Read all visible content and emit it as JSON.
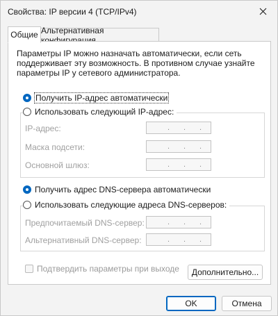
{
  "window": {
    "title": "Свойства: IP версии 4 (TCP/IPv4)"
  },
  "tabs": [
    {
      "label": "Общие",
      "active": true
    },
    {
      "label": "Альтернативная конфигурация",
      "active": false
    }
  ],
  "description": "Параметры IP можно назначать автоматически, если сеть поддерживает эту возможность. В противном случае узнайте параметры IP у сетевого администратора.",
  "ip": {
    "auto_label": "Получить IP-адрес автоматически",
    "auto_selected": true,
    "manual_label": "Использовать следующий IP-адрес:",
    "manual_selected": false,
    "fields": [
      {
        "label": "IP-адрес:",
        "value": ". . ."
      },
      {
        "label": "Маска подсети:",
        "value": ". . ."
      },
      {
        "label": "Основной шлюз:",
        "value": ". . ."
      }
    ]
  },
  "dns": {
    "auto_label": "Получить адрес DNS-сервера автоматически",
    "auto_selected": true,
    "manual_label": "Использовать следующие адреса DNS-серверов:",
    "manual_selected": false,
    "fields": [
      {
        "label": "Предпочитаемый DNS-сервер:",
        "value": ". . ."
      },
      {
        "label": "Альтернативный DNS-сервер:",
        "value": ". . ."
      }
    ]
  },
  "validate_checkbox": {
    "label": "Подтвердить параметры при выходе",
    "checked": false
  },
  "buttons": {
    "advanced": "Дополнительно...",
    "ok": "OK",
    "cancel": "Отмена"
  },
  "icons": {
    "close": "close-icon"
  },
  "colors": {
    "accent": "#0067c0",
    "background": "#f3f3f3",
    "panel": "#ffffff"
  }
}
